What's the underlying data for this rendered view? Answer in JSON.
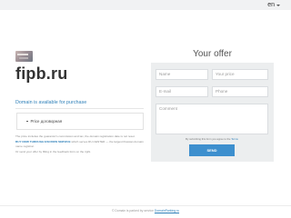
{
  "header": {
    "language": "en"
  },
  "left": {
    "domain_name": "fipb.ru",
    "availability_text": "Domain is available for purchase",
    "price_item": "Price договорная",
    "note": {
      "line1": "The price includes the guarantor's commission and tax, the domain registration date is not reset.",
      "line2_strong": "BUY NOW THROUGH ESCROW SERVICE",
      "line2_rest": "which serves RU-CENTER — the largest Russian domain name registrar.",
      "line3": "Or send your offer by filling in the feedback form on the right."
    }
  },
  "form": {
    "title": "Your offer",
    "name_placeholder": "Name",
    "price_placeholder": "Your price",
    "email_placeholder": "E-mail",
    "phone_placeholder": "Phone",
    "comment_placeholder": "Comment",
    "terms_prefix": "By submitting this form you agree to the",
    "terms_link": "Terms",
    "send_label": "SEND"
  },
  "footer": {
    "text": "© Domain is parked by service",
    "link": "DomainParking.ru"
  },
  "colors": {
    "accent": "#3d8fce",
    "link": "#2d7fb8",
    "panel": "#eceeef"
  }
}
